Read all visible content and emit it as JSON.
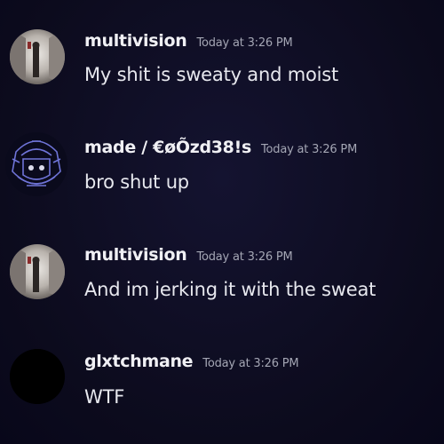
{
  "messages": [
    {
      "username": "multivision",
      "timestamp": "Today at 3:26 PM",
      "text": "My shit is sweaty and moist",
      "avatar_icon": "hallway-figure-avatar"
    },
    {
      "username": "made / €øÕzd38!s",
      "timestamp": "Today at 3:26 PM",
      "text": "bro shut up",
      "avatar_icon": "helmet-line-art-avatar"
    },
    {
      "username": "multivision",
      "timestamp": "Today at 3:26 PM",
      "text": "And im jerking it with the sweat",
      "avatar_icon": "hallway-figure-avatar"
    },
    {
      "username": "glxtchmane",
      "timestamp": "Today at 3:26 PM",
      "text": "WTF",
      "avatar_icon": "black-avatar"
    }
  ],
  "colors": {
    "background": "#0d0c1f",
    "username": "#f0f0f4",
    "timestamp": "#a4a6b4",
    "message_text": "#e7e8ee",
    "avatar_line_art": "#6f74d8"
  }
}
